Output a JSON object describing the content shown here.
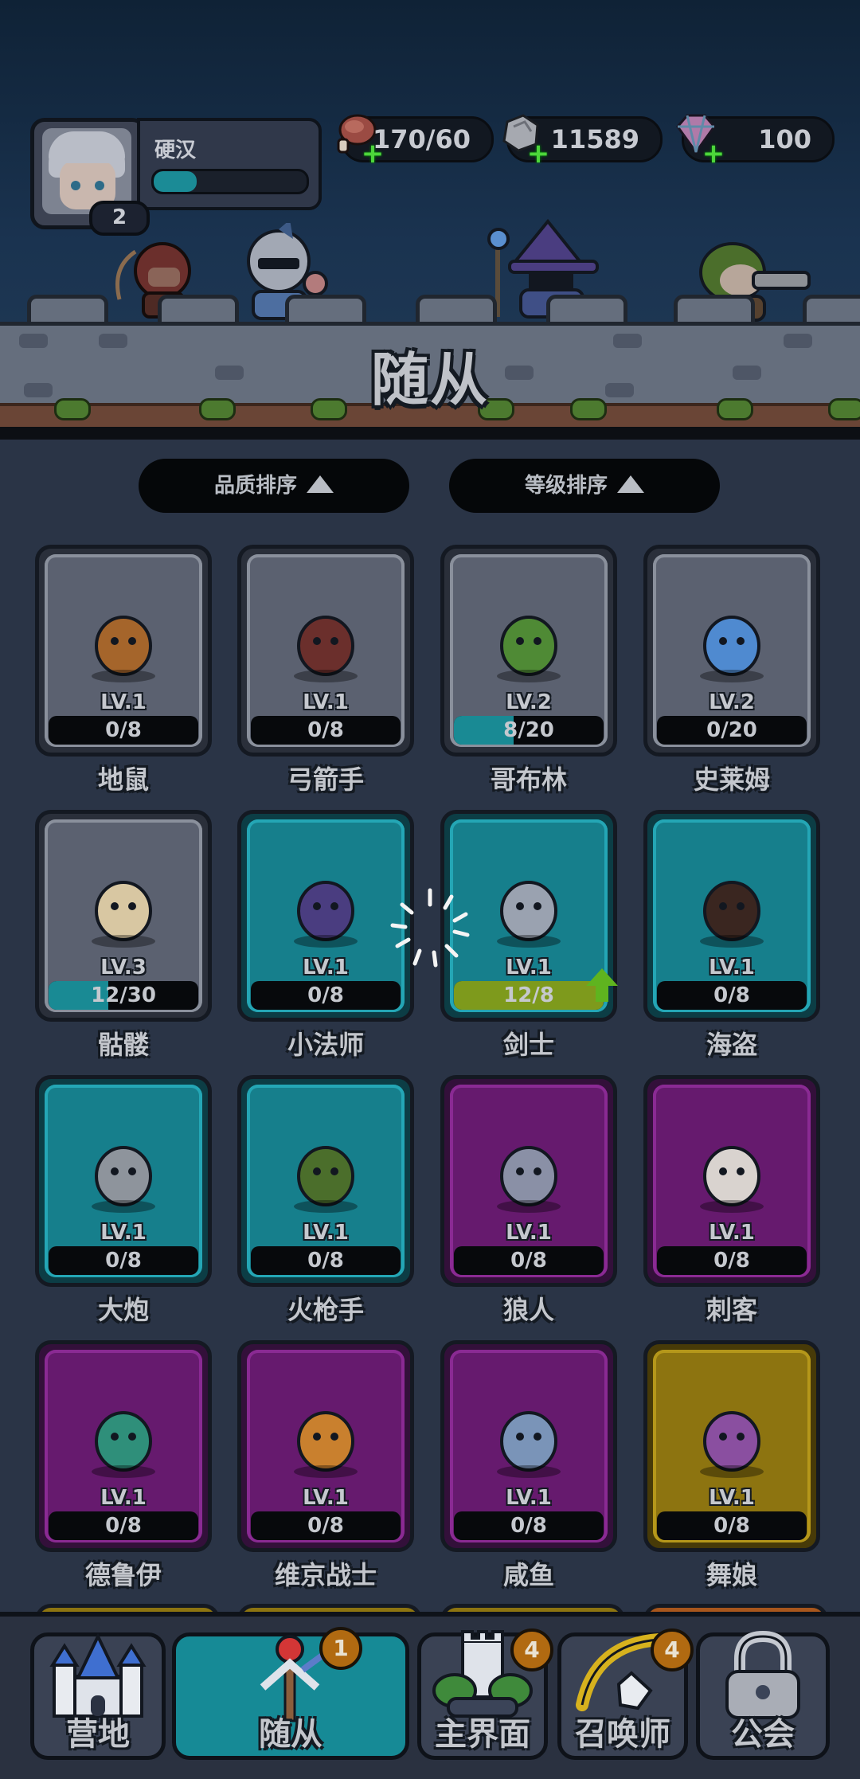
{
  "player": {
    "name": "硬汉",
    "level": "2",
    "xp_fraction": 0.28
  },
  "resources": [
    {
      "icon": "meat-icon",
      "value": "170/60"
    },
    {
      "icon": "stone-icon",
      "value": "11589"
    },
    {
      "icon": "diamond-icon",
      "value": "100"
    }
  ],
  "page_title": "随从",
  "sort": {
    "quality_label": "品质排序",
    "level_label": "等级排序"
  },
  "units": [
    {
      "name": "地鼠",
      "level": "LV.1",
      "progress": "0/8",
      "fraction": 0,
      "quality": "gray"
    },
    {
      "name": "弓箭手",
      "level": "LV.1",
      "progress": "0/8",
      "fraction": 0,
      "quality": "gray"
    },
    {
      "name": "哥布林",
      "level": "LV.2",
      "progress": "8/20",
      "fraction": 0.4,
      "quality": "gray"
    },
    {
      "name": "史莱姆",
      "level": "LV.2",
      "progress": "0/20",
      "fraction": 0,
      "quality": "gray"
    },
    {
      "name": "骷髅",
      "level": "LV.3",
      "progress": "12/30",
      "fraction": 0.4,
      "quality": "gray"
    },
    {
      "name": "小法师",
      "level": "LV.1",
      "progress": "0/8",
      "fraction": 0,
      "quality": "teal"
    },
    {
      "name": "剑士",
      "level": "LV.1",
      "progress": "12/8",
      "fraction": 1,
      "quality": "teal",
      "upgradable": true
    },
    {
      "name": "海盗",
      "level": "LV.1",
      "progress": "0/8",
      "fraction": 0,
      "quality": "teal"
    },
    {
      "name": "大炮",
      "level": "LV.1",
      "progress": "0/8",
      "fraction": 0,
      "quality": "teal"
    },
    {
      "name": "火枪手",
      "level": "LV.1",
      "progress": "0/8",
      "fraction": 0,
      "quality": "teal"
    },
    {
      "name": "狼人",
      "level": "LV.1",
      "progress": "0/8",
      "fraction": 0,
      "quality": "purple"
    },
    {
      "name": "刺客",
      "level": "LV.1",
      "progress": "0/8",
      "fraction": 0,
      "quality": "purple"
    },
    {
      "name": "德鲁伊",
      "level": "LV.1",
      "progress": "0/8",
      "fraction": 0,
      "quality": "purple"
    },
    {
      "name": "维京战士",
      "level": "LV.1",
      "progress": "0/8",
      "fraction": 0,
      "quality": "purple"
    },
    {
      "name": "咸鱼",
      "level": "LV.1",
      "progress": "0/8",
      "fraction": 0,
      "quality": "purple"
    },
    {
      "name": "舞娘",
      "level": "LV.1",
      "progress": "0/8",
      "fraction": 0,
      "quality": "gold"
    }
  ],
  "nav": {
    "tabs": [
      {
        "label": "营地"
      },
      {
        "label": "随从",
        "badge": "1",
        "active": true
      },
      {
        "label": "主界面",
        "badge": "4"
      },
      {
        "label": "召唤师",
        "badge": "4"
      },
      {
        "label": "公会"
      }
    ]
  },
  "colors": {
    "teal": "#168a96",
    "purple": "#661a6e",
    "gold": "#8d7410",
    "gray": "#5b6170"
  }
}
